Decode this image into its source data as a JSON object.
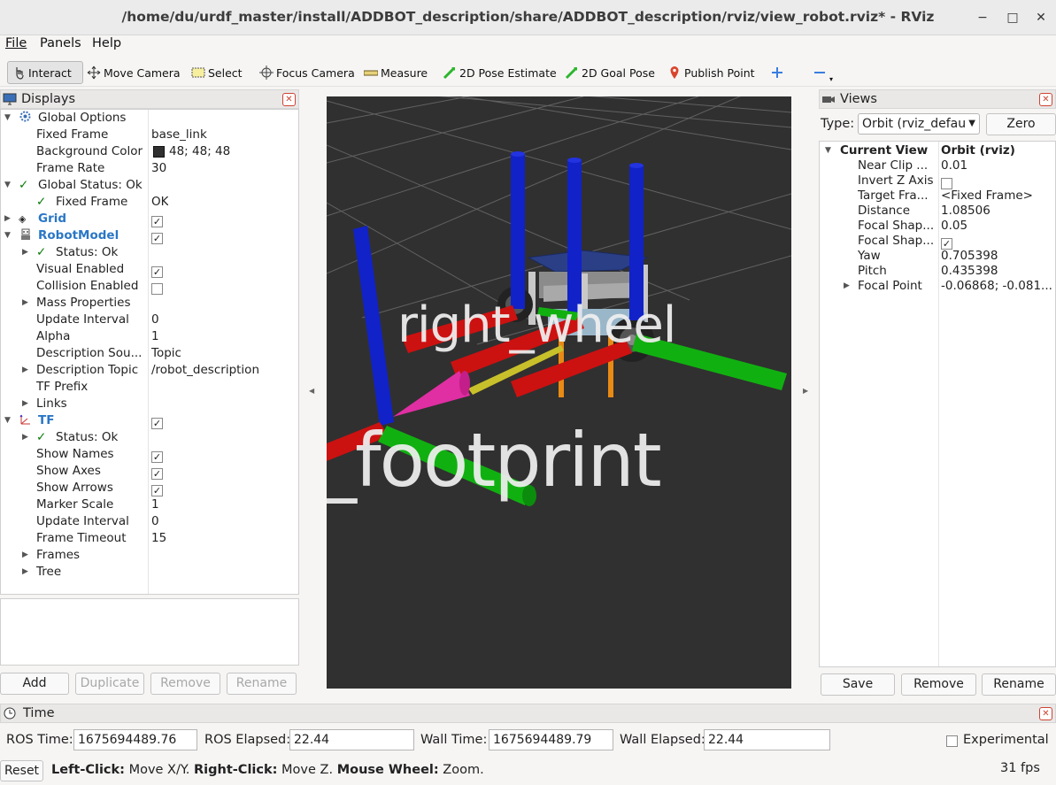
{
  "window": {
    "title": "/home/du/urdf_master/install/ADDBOT_description/share/ADDBOT_description/rviz/view_robot.rviz* - RViz",
    "minimize": "−",
    "maximize": "□",
    "close": "✕"
  },
  "menu": {
    "file": "File",
    "panels": "Panels",
    "help": "Help"
  },
  "toolbar": {
    "interact": "Interact",
    "move_camera": "Move Camera",
    "select": "Select",
    "focus_camera": "Focus Camera",
    "measure": "Measure",
    "pose_estimate": "2D Pose Estimate",
    "goal_pose": "2D Goal Pose",
    "publish_point": "Publish Point"
  },
  "displays": {
    "title": "Displays",
    "rows": [
      {
        "label": "Global Options",
        "value": ""
      },
      {
        "label": "Fixed Frame",
        "value": "base_link"
      },
      {
        "label": "Background Color",
        "value": "48; 48; 48"
      },
      {
        "label": "Frame Rate",
        "value": "30"
      },
      {
        "label": "Global Status: Ok",
        "value": ""
      },
      {
        "label": "Fixed Frame",
        "value": "OK"
      },
      {
        "label": "Grid",
        "value": ""
      },
      {
        "label": "RobotModel",
        "value": ""
      },
      {
        "label": "Status: Ok",
        "value": ""
      },
      {
        "label": "Visual Enabled",
        "value": ""
      },
      {
        "label": "Collision Enabled",
        "value": ""
      },
      {
        "label": "Mass Properties",
        "value": ""
      },
      {
        "label": "Update Interval",
        "value": "0"
      },
      {
        "label": "Alpha",
        "value": "1"
      },
      {
        "label": "Description Sou...",
        "value": "Topic"
      },
      {
        "label": "Description Topic",
        "value": "/robot_description"
      },
      {
        "label": "TF Prefix",
        "value": ""
      },
      {
        "label": "Links",
        "value": ""
      },
      {
        "label": "TF",
        "value": ""
      },
      {
        "label": "Status: Ok",
        "value": ""
      },
      {
        "label": "Show Names",
        "value": ""
      },
      {
        "label": "Show Axes",
        "value": ""
      },
      {
        "label": "Show Arrows",
        "value": ""
      },
      {
        "label": "Marker Scale",
        "value": "1"
      },
      {
        "label": "Update Interval",
        "value": "0"
      },
      {
        "label": "Frame Timeout",
        "value": "15"
      },
      {
        "label": "Frames",
        "value": ""
      },
      {
        "label": "Tree",
        "value": ""
      }
    ],
    "buttons": {
      "add": "Add",
      "duplicate": "Duplicate",
      "remove": "Remove",
      "rename": "Rename"
    }
  },
  "viewport": {
    "label_top": "right_wheel",
    "label_bottom": "_footprint",
    "background_color": "#303030"
  },
  "views": {
    "title": "Views",
    "type_label": "Type:",
    "type_value": "Orbit (rviz_defau",
    "zero": "Zero",
    "header_key": "Current View",
    "header_value": "Orbit (rviz)",
    "rows": [
      {
        "label": "Near Clip ...",
        "value": "0.01"
      },
      {
        "label": "Invert Z Axis",
        "value": ""
      },
      {
        "label": "Target Fra...",
        "value": "<Fixed Frame>"
      },
      {
        "label": "Distance",
        "value": "1.08506"
      },
      {
        "label": "Focal Shap...",
        "value": "0.05"
      },
      {
        "label": "Focal Shap...",
        "value": ""
      },
      {
        "label": "Yaw",
        "value": "0.705398"
      },
      {
        "label": "Pitch",
        "value": "0.435398"
      },
      {
        "label": "Focal Point",
        "value": "-0.06868; -0.081..."
      }
    ],
    "buttons": {
      "save": "Save",
      "remove": "Remove",
      "rename": "Rename"
    }
  },
  "time": {
    "title": "Time",
    "ros_time_label": "ROS Time:",
    "ros_time": "1675694489.76",
    "ros_elapsed_label": "ROS Elapsed:",
    "ros_elapsed": "22.44",
    "wall_time_label": "Wall Time:",
    "wall_time": "1675694489.79",
    "wall_elapsed_label": "Wall Elapsed:",
    "wall_elapsed": "22.44",
    "experimental": "Experimental"
  },
  "status": {
    "reset": "Reset",
    "left_click": "Left-Click:",
    "left_click_desc": "Move X/Y.",
    "right_click": "Right-Click:",
    "right_click_desc": "Move Z.",
    "wheel": "Mouse Wheel:",
    "wheel_desc": "Zoom.",
    "fps": "31 fps"
  }
}
